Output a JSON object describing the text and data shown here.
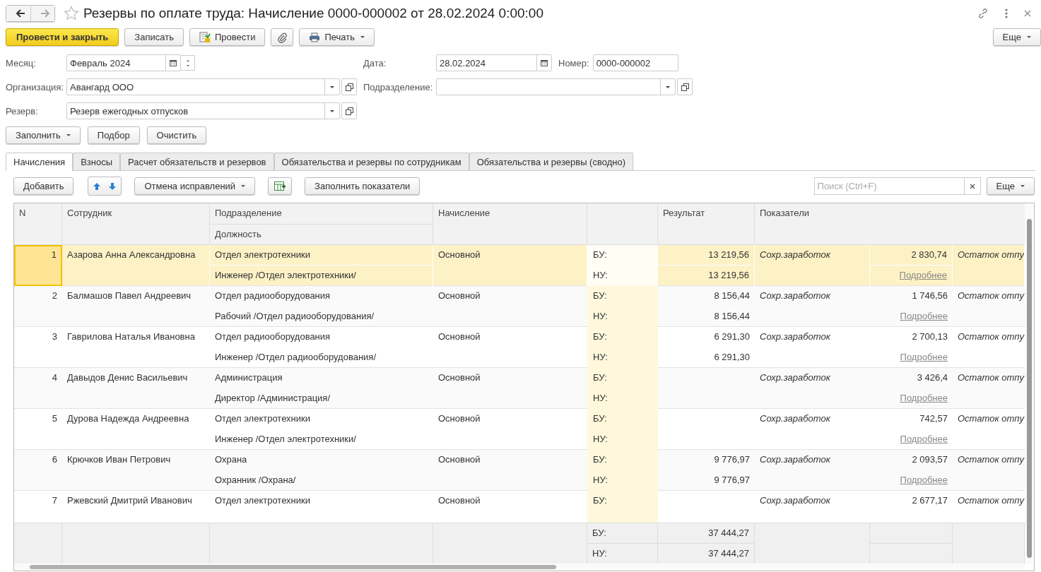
{
  "window": {
    "title": "Резервы по оплате труда: Начисление 0000-000002 от 28.02.2024 0:00:00"
  },
  "command_bar": {
    "post_close": "Провести и закрыть",
    "save": "Записать",
    "post": "Провести",
    "print": "Печать",
    "more": "Еще"
  },
  "fields": {
    "month": {
      "label": "Месяц:",
      "value": "Февраль 2024"
    },
    "date": {
      "label": "Дата:",
      "value": "28.02.2024"
    },
    "number": {
      "label": "Номер:",
      "value": "0000-000002"
    },
    "organization": {
      "label": "Организация:",
      "value": "Авангард ООО"
    },
    "department": {
      "label": "Подразделение:"
    },
    "reserve": {
      "label": "Резерв:",
      "value": "Резерв ежегодных отпусков"
    }
  },
  "fill_buttons": [
    {
      "label": "Заполнить",
      "dropdown": true
    },
    {
      "label": "Подбор",
      "dropdown": false
    },
    {
      "label": "Очистить",
      "dropdown": false
    }
  ],
  "tabs": [
    {
      "label": "Начисления",
      "selected": true
    },
    {
      "label": "Взносы",
      "selected": false
    },
    {
      "label": "Расчет обязательств и резервов",
      "selected": false
    },
    {
      "label": "Обязательства и резервы по сотрудникам",
      "selected": false
    },
    {
      "label": "Обязательства и резервы (сводно)",
      "selected": false
    }
  ],
  "table_toolbar": {
    "add": "Добавить",
    "corrections": "Отмена исправлений",
    "fill_indicators": "Заполнить показатели",
    "search_placeholder": "Поиск (Ctrl+F)",
    "more": "Еще"
  },
  "table": {
    "columns": {
      "n": "N",
      "employee": "Сотрудник",
      "department": "Подразделение",
      "position": "Должность",
      "accrual": "Начисление",
      "result": "Результат",
      "indicators": "Показатели"
    },
    "rows": [
      {
        "n": "1",
        "employee": "Азарова Анна Александровна",
        "department": "Отдел электротехники",
        "position": "Инженер /Отдел электротехники/",
        "accrual": "Основной",
        "bu_label": "БУ:",
        "nu_label": "НУ:",
        "bu": "13 219,56",
        "nu": "13 219,56",
        "indicator": "Сохр.заработок",
        "indicator_value": "2 830,74",
        "details": "Подробнее",
        "next_indicator": "Остаток отпу",
        "selected": true
      },
      {
        "n": "2",
        "employee": "Балмашов Павел Андреевич",
        "department": "Отдел радиооборудования",
        "position": "Рабочий /Отдел радиооборудования/",
        "accrual": "Основной",
        "bu_label": "БУ:",
        "nu_label": "НУ:",
        "bu": "8 156,44",
        "nu": "8 156,44",
        "indicator": "Сохр.заработок",
        "indicator_value": "1 746,56",
        "details": "Подробнее",
        "next_indicator": "Остаток отпу",
        "selected": false
      },
      {
        "n": "3",
        "employee": "Гаврилова Наталья Ивановна",
        "department": "Отдел радиооборудования",
        "position": "Инженер /Отдел радиооборудования/",
        "accrual": "Основной",
        "bu_label": "БУ:",
        "nu_label": "НУ:",
        "bu": "6 291,30",
        "nu": "6 291,30",
        "indicator": "Сохр.заработок",
        "indicator_value": "2 700,13",
        "details": "Подробнее",
        "next_indicator": "Остаток отпу",
        "selected": false
      },
      {
        "n": "4",
        "employee": "Давыдов Денис Васильевич",
        "department": "Администрация",
        "position": "Директор /Администрация/",
        "accrual": "Основной",
        "bu_label": "БУ:",
        "nu_label": "НУ:",
        "indicator": "Сохр.заработок",
        "indicator_value": "3 426,4",
        "details": "Подробнее",
        "next_indicator": "Остаток отпу",
        "selected": false
      },
      {
        "n": "5",
        "employee": "Дурова Надежда Андреевна",
        "department": "Отдел электротехники",
        "position": "Инженер /Отдел электротехники/",
        "accrual": "Основной",
        "bu_label": "БУ:",
        "nu_label": "НУ:",
        "indicator": "Сохр.заработок",
        "indicator_value": "742,57",
        "details": "Подробнее",
        "next_indicator": "Остаток отпу",
        "selected": false
      },
      {
        "n": "6",
        "employee": "Крючков Иван Петрович",
        "department": "Охрана",
        "position": "Охранник /Охрана/",
        "accrual": "Основной",
        "bu_label": "БУ:",
        "nu_label": "НУ:",
        "bu": "9 776,97",
        "nu": "9 776,97",
        "indicator": "Сохр.заработок",
        "indicator_value": "2 093,57",
        "details": "Подробнее",
        "next_indicator": "Остаток отпу",
        "selected": false
      },
      {
        "n": "7",
        "employee": "Ржевский Дмитрий Иванович",
        "department": "Отдел электротехники",
        "accrual": "Основной",
        "bu_label": "БУ:",
        "indicator": "Сохр.заработок",
        "indicator_value": "2 677,17",
        "next_indicator": "Остаток отпу",
        "selected": false
      }
    ],
    "footer": {
      "bu_label": "БУ:",
      "nu_label": "НУ:",
      "bu_total": "37 444,27",
      "nu_total": "37 444,27"
    }
  }
}
